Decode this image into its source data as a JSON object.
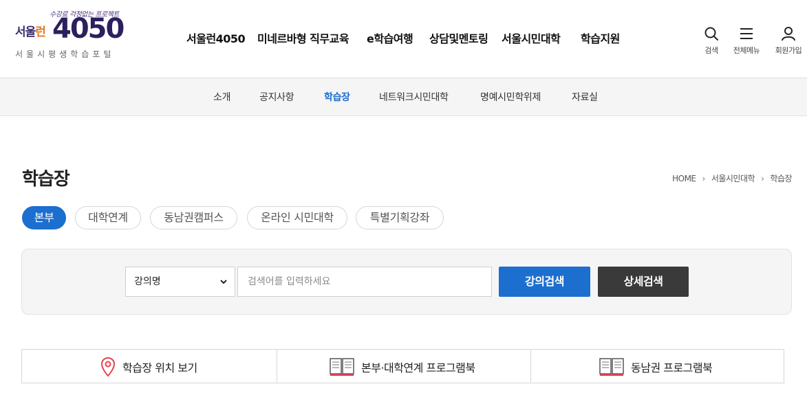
{
  "logo": {
    "slogan": "수강료 걱정없는 프로젝트",
    "seoul": "서울",
    "run": "런",
    "number": "4050",
    "tagline": "서울시평생학습포털"
  },
  "gnb": [
    "서울런4050",
    "미네르바형 직무교육",
    "e학습여행",
    "상담및멘토링",
    "서울시민대학",
    "학습지원"
  ],
  "utility": {
    "search": "검색",
    "menu": "전체메뉴",
    "join": "회원가입"
  },
  "subnav": {
    "items": [
      "소개",
      "공지사항",
      "학습장",
      "네트워크시민대학",
      "명예시민학위제",
      "자료실"
    ],
    "active": "학습장"
  },
  "page": {
    "title": "학습장"
  },
  "breadcrumb": [
    "HOME",
    "서울시민대학",
    "학습장"
  ],
  "tabs": {
    "items": [
      "본부",
      "대학연계",
      "동남권캠퍼스",
      "온라인 시민대학",
      "특별기획강좌"
    ],
    "active": "본부"
  },
  "search": {
    "select_value": "강의명",
    "placeholder": "검색어를 입력하세요",
    "search_button": "강의검색",
    "detail_button": "상세검색"
  },
  "quick_links": [
    "학습장 위치 보기",
    "본부·대학연계 프로그램북",
    "동남권 프로그램북"
  ],
  "colors": {
    "accent": "#1d6fcf",
    "dark_button": "#3a3a3a",
    "pin": "#e8414d"
  }
}
